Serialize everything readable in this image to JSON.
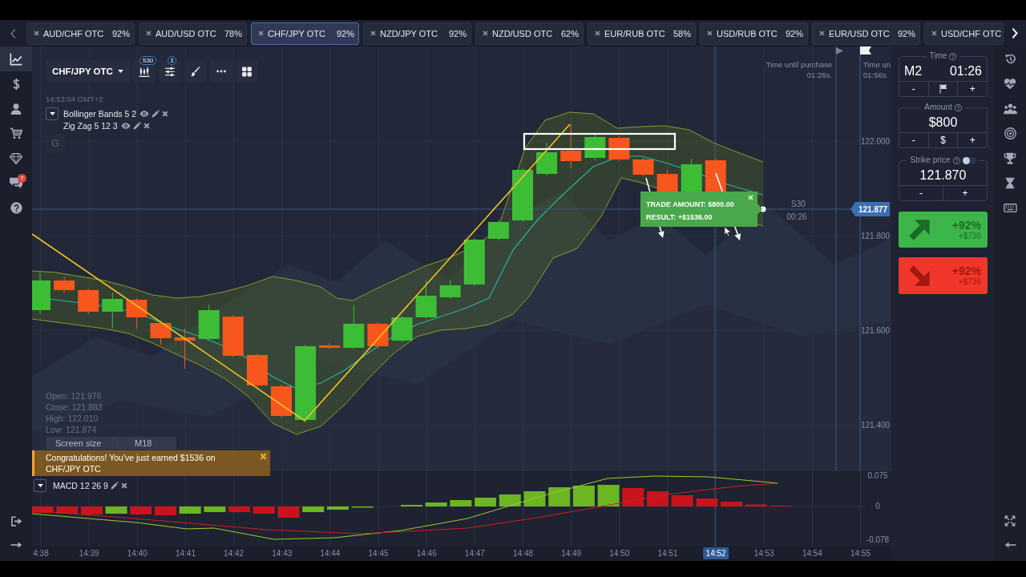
{
  "tabs_bar": {
    "tabs": [
      {
        "label": "AUD/CHF OTC",
        "payout": "92%",
        "selected": false
      },
      {
        "label": "AUD/USD OTC",
        "payout": "78%",
        "selected": false
      },
      {
        "label": "CHF/JPY OTC",
        "payout": "92%",
        "selected": true
      },
      {
        "label": "NZD/JPY OTC",
        "payout": "92%",
        "selected": false
      },
      {
        "label": "NZD/USD OTC",
        "payout": "62%",
        "selected": false
      },
      {
        "label": "EUR/RUB OTC",
        "payout": "58%",
        "selected": false
      },
      {
        "label": "USD/RUB OTC",
        "payout": "92%",
        "selected": false
      },
      {
        "label": "EUR/USD OTC",
        "payout": "92%",
        "selected": false
      },
      {
        "label": "USD/CHF OTC",
        "selected": false
      }
    ]
  },
  "sidebar": {
    "items": [
      {
        "selected": true
      },
      {
        "selected": false
      },
      {
        "selected": false
      },
      {
        "selected": false
      },
      {
        "selected": false
      },
      {
        "selected": false,
        "badge": "7"
      },
      {
        "selected": false
      }
    ]
  },
  "chart": {
    "toolbar": {
      "asset": "CHF/JPY OTC",
      "timeframe_badge": "S30",
      "indicator_count": "3"
    },
    "server_time": "14:53:04 GMT+2",
    "indicators": [
      {
        "name": "Bollinger Bands 5 2"
      },
      {
        "name": "Zig Zag 5 12 3"
      }
    ],
    "drawing_button": "G",
    "purchase_timers": [
      {
        "label": "Time until purchase",
        "value": "01:26s."
      },
      {
        "label": "Time un",
        "value": "01:56s."
      }
    ],
    "price_ticks": [
      "122.000",
      "121.800",
      "121.600",
      "121.400"
    ],
    "current_price": "121.877",
    "candle_timer": {
      "period": "S30",
      "remaining": "00:26"
    },
    "trade_popup": {
      "amount": "TRADE AMOUNT: $800.00",
      "result": "RESULT: +$1536.00"
    },
    "ohlc": [
      "Open: 121.976",
      "Close: 121.883",
      "High: 122.010",
      "Low: 121.874"
    ],
    "screen_size": {
      "label": "Screen size",
      "value": "M18"
    },
    "notification": {
      "message": "Congratulations! You've just earned $1536 on CHF/JPY OTC"
    },
    "macd": {
      "name": "MACD 12 26 9",
      "ticks": [
        "0.075",
        "0",
        "-0.078"
      ]
    },
    "time_axis": [
      {
        "label": "4:38",
        "current": false
      },
      {
        "label": "14:39",
        "current": false
      },
      {
        "label": "14:40",
        "current": false
      },
      {
        "label": "14:41",
        "current": false
      },
      {
        "label": "14:42",
        "current": false
      },
      {
        "label": "14:43",
        "current": false
      },
      {
        "label": "14:44",
        "current": false
      },
      {
        "label": "14:45",
        "current": false
      },
      {
        "label": "14:46",
        "current": false
      },
      {
        "label": "14:47",
        "current": false
      },
      {
        "label": "14:48",
        "current": false
      },
      {
        "label": "14:49",
        "current": false
      },
      {
        "label": "14:50",
        "current": false
      },
      {
        "label": "14:51",
        "current": false
      },
      {
        "label": "14:52",
        "current": true
      },
      {
        "label": "14:53",
        "current": false
      },
      {
        "label": "14:54",
        "current": false
      },
      {
        "label": "14:55",
        "current": false
      }
    ]
  },
  "trade_panel": {
    "time": {
      "label": "Time",
      "timeframe": "M2",
      "value": "01:26",
      "minus": "-",
      "plus": "+"
    },
    "amount": {
      "label": "Amount",
      "value": "$800",
      "minus": "-",
      "currency": "$",
      "plus": "+"
    },
    "strike": {
      "label": "Strike price",
      "toggle_on": false,
      "value": "121.870",
      "minus": "-",
      "plus": "+"
    },
    "up": {
      "payout": "+92%",
      "profit": "+$736"
    },
    "down": {
      "payout": "+92%",
      "profit": "+$736"
    }
  }
}
